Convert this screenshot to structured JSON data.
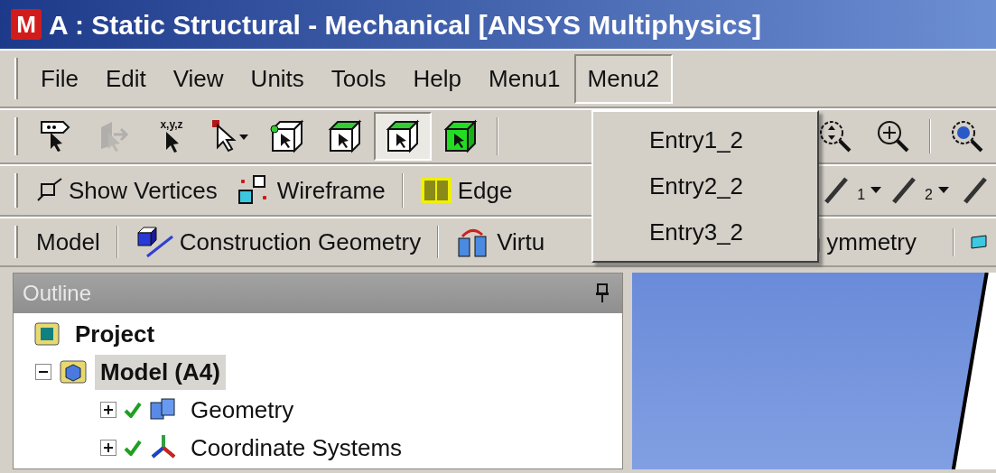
{
  "window": {
    "icon_letter": "M",
    "title": "A : Static Structural - Mechanical [ANSYS Multiphysics]"
  },
  "menu_bar": [
    {
      "label": "File",
      "selected": false
    },
    {
      "label": "Edit",
      "selected": false
    },
    {
      "label": "View",
      "selected": false
    },
    {
      "label": "Units",
      "selected": false
    },
    {
      "label": "Tools",
      "selected": false
    },
    {
      "label": "Help",
      "selected": false
    },
    {
      "label": "Menu1",
      "selected": false
    },
    {
      "label": "Menu2",
      "selected": true
    }
  ],
  "open_menu": {
    "entries": [
      "Entry1_2",
      "Entry2_2",
      "Entry3_2"
    ]
  },
  "toolbar_1": {
    "left": [
      {
        "kind": "label-pick",
        "pressed": false,
        "disabled": false
      },
      {
        "kind": "vertex-pick",
        "pressed": false,
        "disabled": true
      },
      {
        "kind": "coordinate-pick",
        "caption": "x,y,z",
        "pressed": false,
        "disabled": false
      },
      {
        "kind": "select-mode",
        "pressed": false,
        "disabled": false
      },
      {
        "kind": "vertex-cube",
        "pressed": false,
        "disabled": false
      },
      {
        "kind": "edge-cube",
        "pressed": false,
        "disabled": false
      },
      {
        "kind": "face-cube",
        "pressed": true,
        "disabled": false
      },
      {
        "kind": "body-cube",
        "pressed": false,
        "disabled": false
      }
    ],
    "right": [
      {
        "kind": "zoom-box",
        "pressed": false,
        "disabled": false
      },
      {
        "kind": "zoom-in",
        "pressed": false,
        "disabled": false
      },
      {
        "kind": "view-globe",
        "pressed": false,
        "disabled": false
      }
    ]
  },
  "toolbar_2": {
    "left": [
      {
        "kind": "show-vertices",
        "label": "Show Vertices"
      },
      {
        "kind": "wireframe",
        "label": "Wireframe"
      },
      {
        "kind": "edge-coloring",
        "label": "Edge"
      }
    ],
    "right": [
      {
        "kind": "edge-tool",
        "caption": "1"
      },
      {
        "kind": "edge-tool",
        "caption": "2"
      },
      {
        "kind": "edge-slash"
      }
    ]
  },
  "toolbar_3": {
    "left": [
      {
        "kind": "text",
        "label": "Model"
      },
      {
        "kind": "construction-geometry",
        "label": "Construction Geometry"
      },
      {
        "kind": "virtual-topology",
        "label": "Virtu"
      }
    ],
    "right": [
      {
        "kind": "symmetry",
        "label": "ymmetry"
      },
      {
        "kind": "flag"
      }
    ]
  },
  "outline": {
    "title": "Outline",
    "tree": [
      {
        "label": "Project",
        "kind": "project",
        "bold": true,
        "selected": false,
        "children": [
          {
            "label": "Model (A4)",
            "kind": "model",
            "bold": true,
            "selected": true,
            "expanded": true,
            "children": [
              {
                "label": "Geometry",
                "kind": "geometry",
                "bold": false,
                "selected": false,
                "expanded": false,
                "ok": true
              },
              {
                "label": "Coordinate Systems",
                "kind": "coordinates",
                "bold": false,
                "selected": false,
                "expanded": false,
                "ok": true
              }
            ]
          }
        ]
      }
    ]
  }
}
